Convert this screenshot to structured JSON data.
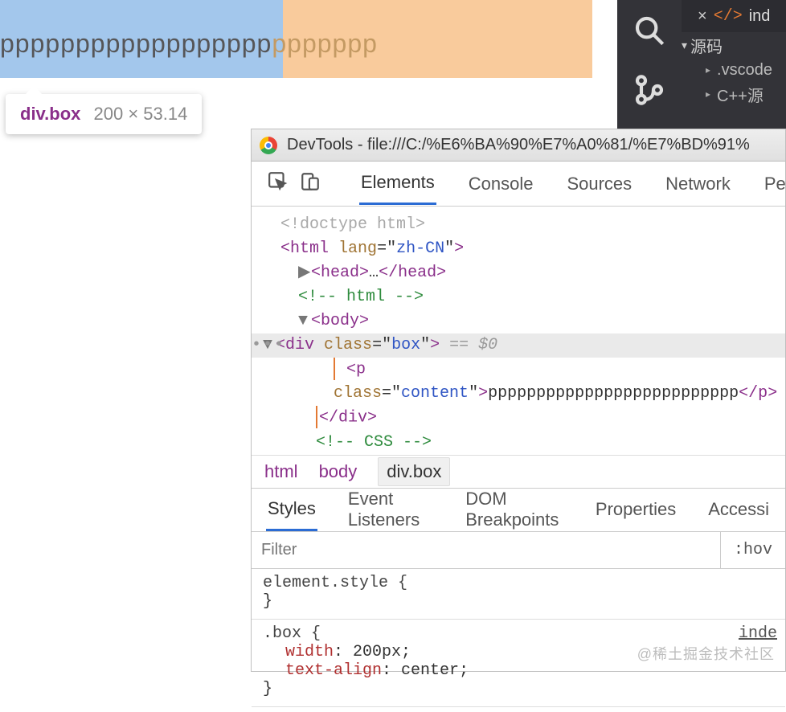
{
  "page": {
    "p_visible": "pppppppppppppppppp",
    "p_overflow": "ppppppp"
  },
  "inspect_tip": {
    "selector_tag": "div",
    "selector_class": ".box",
    "dims": "200 × 53.14"
  },
  "editor": {
    "file_icon": "</>",
    "file_label": "ind",
    "section": "源码",
    "tree": [
      ".vscode",
      "C++源"
    ]
  },
  "devtools": {
    "title_prefix": "DevTools - ",
    "title_path": "file:///C:/%E6%BA%90%E7%A0%81/%E7%BD%91%",
    "tabs": [
      "Elements",
      "Console",
      "Sources",
      "Network",
      "Perfo"
    ],
    "active_tab": 0,
    "tree": {
      "doctype": "<!doctype html>",
      "html_open": {
        "tag": "html",
        "attr": "lang",
        "val": "zh-CN"
      },
      "head": "head",
      "ellipsis": "…",
      "comment_html": "<!-- html -->",
      "body": "body",
      "sel_div": {
        "tag": "div",
        "attr": "class",
        "val": "box",
        "suffix": "== $0"
      },
      "p_line": {
        "tag": "p",
        "attr": "class",
        "val": "content",
        "text": "pppppppppppppppppppppppppp"
      },
      "div_close": "div",
      "comment_css": "<!-- CSS -->"
    },
    "breadcrumb": [
      "html",
      "body",
      "div.box"
    ],
    "subtabs": [
      "Styles",
      "Event Listeners",
      "DOM Breakpoints",
      "Properties",
      "Accessi"
    ],
    "filter_placeholder": "Filter",
    "hov_label": ":hov",
    "styles": {
      "rule1_sel": "element.style {",
      "rule1_close": "}",
      "rule2_sel": ".box {",
      "rule2_link": "inde",
      "rule2_p1_name": "width",
      "rule2_p1_val": "200px",
      "rule2_p2_name": "text-align",
      "rule2_p2_val": "center",
      "rule2_close": "}"
    }
  },
  "watermark": "@稀土掘金技术社区"
}
